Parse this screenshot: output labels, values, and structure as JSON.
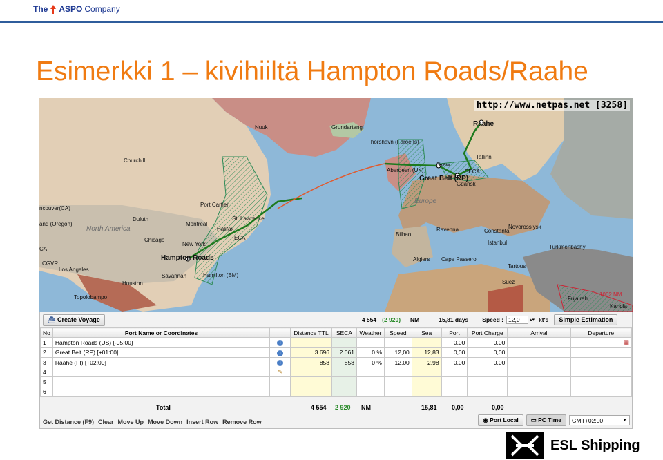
{
  "header": {
    "brand_prefix": "The",
    "brand_name": "ASPO",
    "brand_suffix": "Company",
    "accent_color": "#f07b12"
  },
  "slide_title": "Esimerkki 1 – kivihiiltä Hampton Roads/Raahe",
  "map": {
    "url_label": "http://www.netpas.net [3258]",
    "labels": {
      "nuuk": "Nuuk",
      "grundartangi": "Grundartangi",
      "thorshavn": "Thorshavn (Faroe Is)",
      "raahe": "Raahe",
      "tallinn": "Tallinn",
      "seca": "SECA",
      "aberdeen": "Aberdeen (UK)",
      "skaw": "Skaw",
      "great_belt": "Great Belt (RP)",
      "gdansk": "Gdansk",
      "europe": "Europe",
      "churchill": "Churchill",
      "port_cartier": "Port Cartier",
      "vancouver": "ncouver(CA)",
      "oregon": "and (Oregon)",
      "duluth": "Duluth",
      "montreal": "Montreal",
      "st_lawrence": "St. Lawrence",
      "halifax": "Halifax",
      "north_america": "North America",
      "chicago": "Chicago",
      "new_york": "New York",
      "eca": "ECA",
      "hampton_roads": "Hampton Roads",
      "ca": "CA",
      "cgvr": "CGVR",
      "los_angeles": "Los Angeles",
      "savannah": "Savannah",
      "hamilton": "Hamilton (BM)",
      "houston": "Houston",
      "topolobampo": "Topolobampo",
      "bilbao": "Bilbao",
      "ravenna": "Ravenna",
      "constanta": "Constanta",
      "novorossiysk": "Novorossiysk",
      "istanbul": "Istanbul",
      "turkmenbashy": "Turkmenbashy",
      "algiers": "Algiers",
      "cape_passero": "Cape Passero",
      "tartous": "Tartous",
      "suez": "Suez",
      "fujairah": "Fujairah",
      "kandla": "Kandla",
      "nm_1062": "1062 NM"
    }
  },
  "panel": {
    "create_voyage": "Create Voyage",
    "summary_distance": "4 554",
    "summary_seca": "(2 920)",
    "summary_nm": "NM",
    "summary_days": "15,81 days",
    "speed_label": "Speed :",
    "speed_value": "12,0",
    "speed_unit": "kt's",
    "simple_estimation": "Simple Estimation",
    "columns": [
      "No",
      "Port Name or Coordinates",
      "",
      "Distance TTL",
      "SECA",
      "Weather",
      "Speed",
      "Sea",
      "Port",
      "Port Charge",
      "Arrival",
      "Departure"
    ],
    "rows": [
      {
        "no": "1",
        "port": "Hampton Roads (US) [-05:00]",
        "dist": "",
        "seca": "",
        "weather": "",
        "speed": "",
        "sea": "",
        "portd": "0,00",
        "charge": "0,00"
      },
      {
        "no": "2",
        "port": "Great Belt (RP) [+01:00]",
        "dist": "3 696",
        "seca": "2 061",
        "weather": "0 %",
        "speed": "12,00",
        "sea": "12,83",
        "portd": "0,00",
        "charge": "0,00"
      },
      {
        "no": "3",
        "port": "Raahe (FI) [+02:00]",
        "dist": "858",
        "seca": "858",
        "weather": "0 %",
        "speed": "12,00",
        "sea": "2,98",
        "portd": "0,00",
        "charge": "0,00"
      },
      {
        "no": "4",
        "port": "",
        "dist": "",
        "seca": "",
        "weather": "",
        "speed": "",
        "sea": "",
        "portd": "",
        "charge": ""
      },
      {
        "no": "5",
        "port": "",
        "dist": "",
        "seca": "",
        "weather": "",
        "speed": "",
        "sea": "",
        "portd": "",
        "charge": ""
      },
      {
        "no": "6",
        "port": "",
        "dist": "",
        "seca": "",
        "weather": "",
        "speed": "",
        "sea": "",
        "portd": "",
        "charge": ""
      }
    ],
    "total": {
      "label": "Total",
      "dist": "4 554",
      "seca": "2 920",
      "unit": "NM",
      "sea": "15,81",
      "port": "0,00",
      "charge": "0,00"
    },
    "links": [
      "Get Distance (F9)",
      "Clear",
      "Move Up",
      "Move Down",
      "Insert Row",
      "Remove Row"
    ],
    "port_local": "Port Local",
    "pc_time": "PC Time",
    "timezone": "GMT+02:00"
  },
  "footer": {
    "brand": "ESL Shipping"
  }
}
